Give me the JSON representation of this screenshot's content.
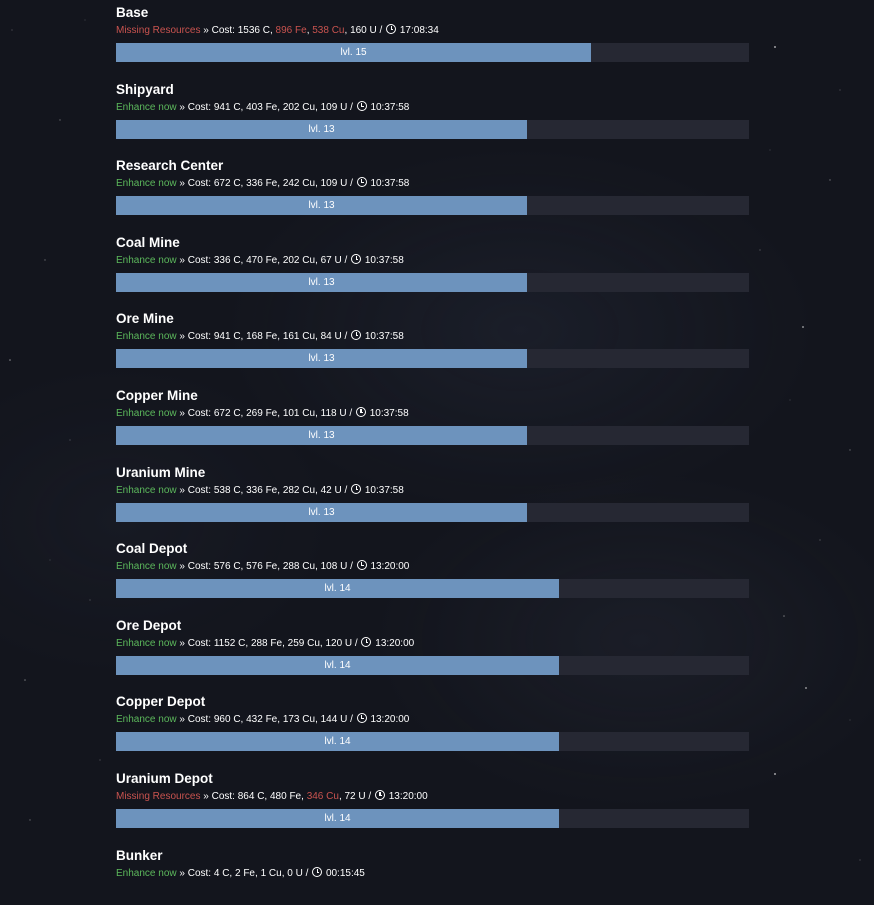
{
  "buildings": [
    {
      "name": "Base",
      "status": "Missing Resources",
      "status_color": "#c9534f",
      "cost_prefix": " » Cost: ",
      "c": "1536 C",
      "fe": "896 Fe",
      "fe_missing": true,
      "cu": "538 Cu",
      "cu_missing": true,
      "u": "160 U",
      "time": "17:08:34",
      "level": "lvl. 15",
      "progress": 0.75
    },
    {
      "name": "Shipyard",
      "status": "Enhance now",
      "status_color": "#5cb85c",
      "cost_prefix": " » Cost: ",
      "c": "941 C",
      "fe": "403 Fe",
      "fe_missing": false,
      "cu": "202 Cu",
      "cu_missing": false,
      "u": "109 U",
      "time": "10:37:58",
      "level": "lvl. 13",
      "progress": 0.65
    },
    {
      "name": "Research Center",
      "status": "Enhance now",
      "status_color": "#5cb85c",
      "cost_prefix": " » Cost: ",
      "c": "672 C",
      "fe": "336 Fe",
      "fe_missing": false,
      "cu": "242 Cu",
      "cu_missing": false,
      "u": "109 U",
      "time": "10:37:58",
      "level": "lvl. 13",
      "progress": 0.65
    },
    {
      "name": "Coal Mine",
      "status": "Enhance now",
      "status_color": "#5cb85c",
      "cost_prefix": " » Cost: ",
      "c": "336 C",
      "fe": "470 Fe",
      "fe_missing": false,
      "cu": "202 Cu",
      "cu_missing": false,
      "u": "67 U",
      "time": "10:37:58",
      "level": "lvl. 13",
      "progress": 0.65
    },
    {
      "name": "Ore Mine",
      "status": "Enhance now",
      "status_color": "#5cb85c",
      "cost_prefix": " » Cost: ",
      "c": "941 C",
      "fe": "168 Fe",
      "fe_missing": false,
      "cu": "161 Cu",
      "cu_missing": false,
      "u": "84 U",
      "time": "10:37:58",
      "level": "lvl. 13",
      "progress": 0.65
    },
    {
      "name": "Copper Mine",
      "status": "Enhance now",
      "status_color": "#5cb85c",
      "cost_prefix": " » Cost: ",
      "c": "672 C",
      "fe": "269 Fe",
      "fe_missing": false,
      "cu": "101 Cu",
      "cu_missing": false,
      "u": "118 U",
      "time": "10:37:58",
      "level": "lvl. 13",
      "progress": 0.65
    },
    {
      "name": "Uranium Mine",
      "status": "Enhance now",
      "status_color": "#5cb85c",
      "cost_prefix": " » Cost: ",
      "c": "538 C",
      "fe": "336 Fe",
      "fe_missing": false,
      "cu": "282 Cu",
      "cu_missing": false,
      "u": "42 U",
      "time": "10:37:58",
      "level": "lvl. 13",
      "progress": 0.65
    },
    {
      "name": "Coal Depot",
      "status": "Enhance now",
      "status_color": "#5cb85c",
      "cost_prefix": " » Cost: ",
      "c": "576 C",
      "fe": "576 Fe",
      "fe_missing": false,
      "cu": "288 Cu",
      "cu_missing": false,
      "u": "108 U",
      "time": "13:20:00",
      "level": "lvl. 14",
      "progress": 0.7
    },
    {
      "name": "Ore Depot",
      "status": "Enhance now",
      "status_color": "#5cb85c",
      "cost_prefix": " » Cost: ",
      "c": "1152 C",
      "fe": "288 Fe",
      "fe_missing": false,
      "cu": "259 Cu",
      "cu_missing": false,
      "u": "120 U",
      "time": "13:20:00",
      "level": "lvl. 14",
      "progress": 0.7
    },
    {
      "name": "Copper Depot",
      "status": "Enhance now",
      "status_color": "#5cb85c",
      "cost_prefix": " » Cost: ",
      "c": "960 C",
      "fe": "432 Fe",
      "fe_missing": false,
      "cu": "173 Cu",
      "cu_missing": false,
      "u": "144 U",
      "time": "13:20:00",
      "level": "lvl. 14",
      "progress": 0.7
    },
    {
      "name": "Uranium Depot",
      "status": "Missing Resources",
      "status_color": "#c9534f",
      "cost_prefix": " » Cost: ",
      "c": "864 C",
      "fe": "480 Fe",
      "fe_missing": false,
      "cu": "346 Cu",
      "cu_missing": true,
      "u": "72 U",
      "time": "13:20:00",
      "level": "lvl. 14",
      "progress": 0.7
    },
    {
      "name": "Bunker",
      "status": "Enhance now",
      "status_color": "#5cb85c",
      "cost_prefix": " » Cost: ",
      "c": "4 C",
      "fe": "2 Fe",
      "fe_missing": false,
      "cu": "1 Cu",
      "cu_missing": false,
      "u": "0 U",
      "time": "00:15:45",
      "level": "",
      "progress": 0
    }
  ],
  "colors": {
    "background": "#13151d",
    "bar_fill": "#6d93bd",
    "bar_track": "#262833",
    "ok": "#5cb85c",
    "missing": "#c9534f"
  },
  "icons": {
    "time": "clock-icon"
  }
}
